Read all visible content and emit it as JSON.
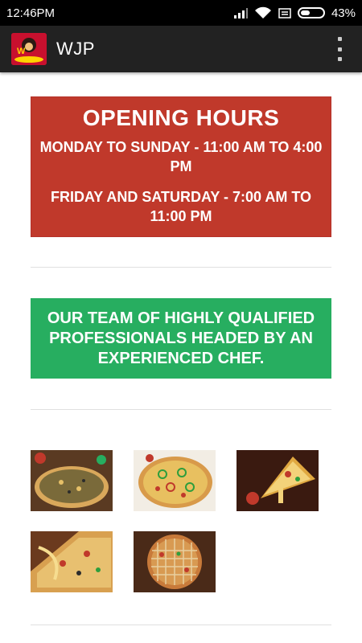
{
  "status": {
    "time": "12:46PM",
    "battery": "43%",
    "battery_level": 0.43
  },
  "app": {
    "title": "WJP",
    "logo_text": "WJP"
  },
  "hours": {
    "title": "OPENING HOURS",
    "line1": "MONDAY TO SUNDAY - 11:00 AM TO 4:00 PM",
    "line2": "FRIDAY AND SATURDAY - 7:00 AM TO 11:00 PM"
  },
  "team": {
    "text": "OUR TEAM OF HIGHLY QUALIFIED PROFESSIONALS HEADED BY AN EXPERIENCED CHEF."
  },
  "gallery": [
    "pizza-photo-1",
    "pizza-photo-2",
    "pizza-photo-3",
    "pizza-photo-4",
    "pizza-photo-5"
  ],
  "colors": {
    "hours_bg": "#c0392b",
    "team_bg": "#27ae60",
    "app_bar": "#222222"
  }
}
